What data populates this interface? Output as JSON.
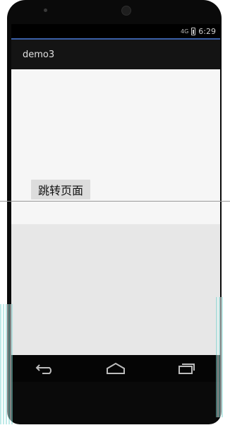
{
  "status_bar": {
    "network": "4G",
    "time": "6:29"
  },
  "action_bar": {
    "title": "demo3"
  },
  "main": {
    "jump_button_label": "跳转页面"
  },
  "nav_bar": {
    "back_icon": "back-icon",
    "home_icon": "home-icon",
    "recents_icon": "recents-icon"
  },
  "colors": {
    "action_bar": "#141414",
    "accent_line": "#3a5fa6",
    "status_bar": "#000000",
    "content": "#f6f6f6"
  }
}
